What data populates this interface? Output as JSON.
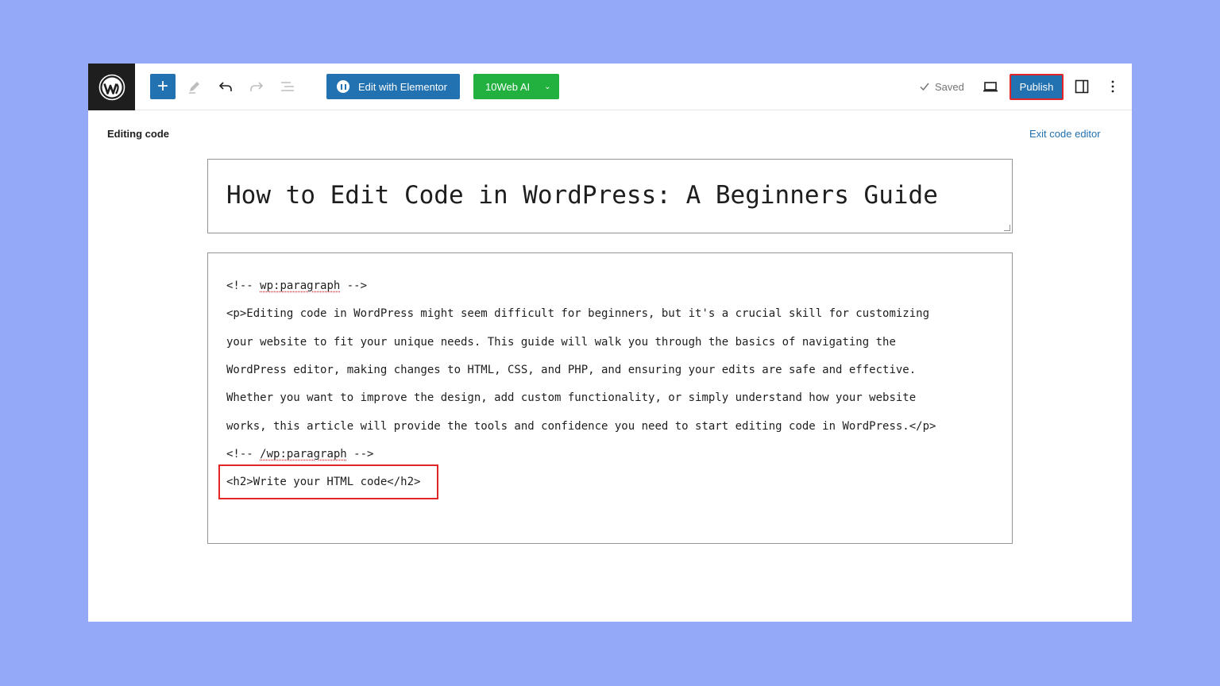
{
  "toolbar": {
    "elementor_label": "Edit with Elementor",
    "tenweb_label": "10Web AI",
    "saved_label": "Saved",
    "publish_label": "Publish"
  },
  "editor": {
    "mode_label": "Editing code",
    "exit_label": "Exit code editor",
    "title": "How to Edit Code in WordPress: A Beginners Guide",
    "code": {
      "comment_open_prefix": "<!-- ",
      "comment_open_word": "wp:paragraph",
      "comment_open_suffix": " -->",
      "p_line_1": "<p>Editing code in WordPress might seem difficult for beginners, but it's a crucial skill for customizing",
      "p_line_2": "your website to fit your unique needs. This guide will walk you through the basics of navigating the",
      "p_line_3": "WordPress editor, making changes to HTML, CSS, and PHP, and ensuring your edits are safe and effective.",
      "p_line_4": "Whether you want to improve the design, add custom functionality, or simply understand how your website",
      "p_line_5": "works, this article will provide the tools and confidence you need to start editing code in WordPress.</p>",
      "comment_close_prefix": "<!-- ",
      "comment_close_word": "/wp:paragraph",
      "comment_close_suffix": " -->",
      "h2_line": "<h2>Write your HTML code</h2>"
    }
  },
  "colors": {
    "background": "#94a9f8",
    "accent_blue": "#2271b1",
    "tenweb_green": "#22b13f",
    "highlight_red": "#e02626"
  },
  "icons": [
    "wordpress-logo-icon",
    "plus-icon",
    "pencil-icon",
    "undo-icon",
    "redo-icon",
    "list-view-icon",
    "elementor-icon",
    "chevron-down-icon",
    "check-icon",
    "desktop-preview-icon",
    "sidebar-toggle-icon",
    "more-options-icon"
  ]
}
